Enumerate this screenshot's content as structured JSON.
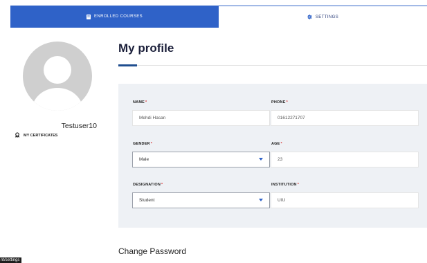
{
  "tabs": {
    "enrolled": {
      "label": "ENROLLED COURSES",
      "icon": "book-icon"
    },
    "settings": {
      "label": "SETTINGS",
      "icon": "gear-icon"
    }
  },
  "sidebar": {
    "username": "Testuser10",
    "certificates_label": "MY CERTIFICATES",
    "certificates_icon": "certificate-icon"
  },
  "main": {
    "title": "My profile",
    "form": {
      "name": {
        "label": "NAME",
        "value": "Mehdi Hasan"
      },
      "phone": {
        "label": "PHONE",
        "value": "01612271707"
      },
      "gender": {
        "label": "GENDER",
        "value": "Male"
      },
      "age": {
        "label": "AGE",
        "value": "23"
      },
      "designation": {
        "label": "DESIGNATION",
        "value": "Student"
      },
      "institution": {
        "label": "INSTITUTION",
        "value": "UIU"
      },
      "required_mark": "*"
    },
    "change_password_title": "Change Password"
  },
  "status_bar": {
    "url_fragment": "nt/settings"
  },
  "colors": {
    "accent": "#2f62c8",
    "required": "#d83a3a",
    "panel": "#eef1f5",
    "title_accent": "#1f4e8f"
  }
}
